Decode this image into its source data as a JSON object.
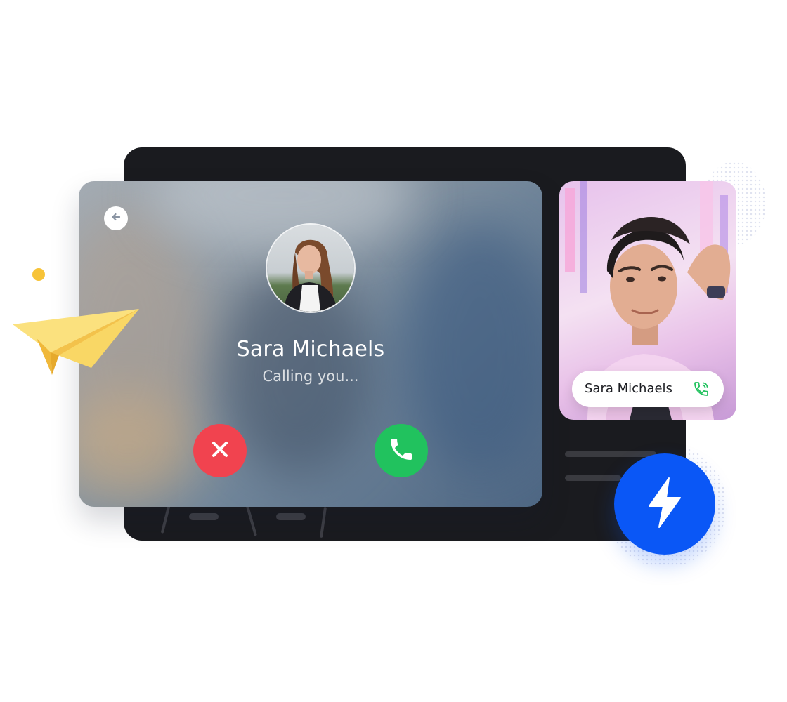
{
  "incoming_call": {
    "caller_name": "Sara Michaels",
    "status_text": "Calling you...",
    "back_icon": "arrow-left-icon",
    "decline_icon": "close-icon",
    "accept_icon": "phone-icon"
  },
  "video_tile": {
    "name": "Sara Michaels",
    "icon": "phone-ringing-icon"
  },
  "badge": {
    "icon": "lightning-bolt-icon",
    "color": "#0a57f6"
  },
  "colors": {
    "decline": "#f1434f",
    "accept": "#21c25e",
    "accent_yellow": "#f7c338",
    "device_frame": "#1a1b1f"
  }
}
